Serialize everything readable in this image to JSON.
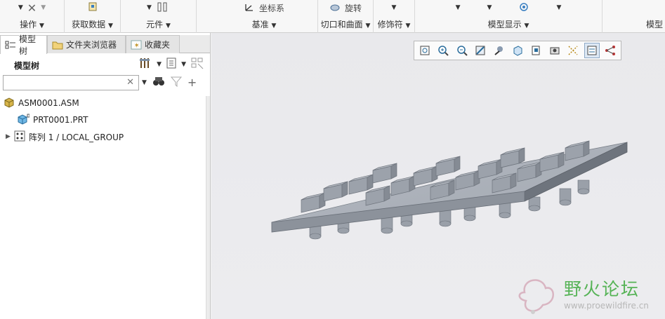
{
  "ribbon": {
    "groups": [
      {
        "label": "操作",
        "tools_text": ""
      },
      {
        "label": "获取数据",
        "tools_text": ""
      },
      {
        "label": "元件",
        "tools_text": ""
      },
      {
        "label": "基准",
        "tools_text": "坐标系"
      },
      {
        "label": "切口和曲面",
        "tools_text": "旋转"
      },
      {
        "label": "修饰符",
        "tools_text": ""
      },
      {
        "label": "模型显示",
        "tools_text": ""
      },
      {
        "label": "模型"
      }
    ]
  },
  "left_pane": {
    "tabs": [
      {
        "label": "模型树"
      },
      {
        "label": "文件夹浏览器"
      },
      {
        "label": "收藏夹"
      }
    ],
    "tree_title": "模型树",
    "search": {
      "value": "",
      "placeholder": ""
    },
    "tree_nodes": [
      {
        "label": "ASM0001.ASM",
        "icon": "assembly-icon"
      },
      {
        "label": "PRT0001.PRT",
        "icon": "part-icon"
      },
      {
        "label": "阵列 1 / LOCAL_GROUP",
        "icon": "pattern-icon"
      }
    ]
  },
  "graphics": {
    "view_toolbar": [
      "refit-icon",
      "zoom-in-icon",
      "zoom-out-icon",
      "repaint-icon",
      "display-style-icon",
      "saved-orientations-icon",
      "view-manager-icon",
      "perspective-icon",
      "annotation-display-icon",
      "datum-display-icon",
      "spin-center-icon"
    ]
  },
  "watermark": {
    "title": "野火论坛",
    "url": "www.proewildfire.cn"
  },
  "colors": {
    "model_top": "#a9aeb6",
    "model_side": "#7d838c",
    "watermark_green": "#56b356",
    "toolbar_active": "#dde8f4"
  }
}
